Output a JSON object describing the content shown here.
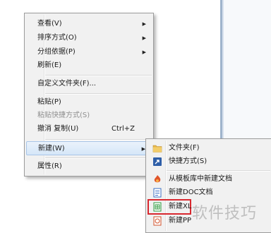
{
  "context_menu": {
    "items": [
      {
        "label": "查看(V)"
      },
      {
        "label": "排序方式(O)"
      },
      {
        "label": "分组依据(P)"
      },
      {
        "label": "刷新(E)"
      },
      {
        "label": "自定义文件夹(F)..."
      },
      {
        "label": "粘贴(P)"
      },
      {
        "label": "粘贴快捷方式(S)"
      },
      {
        "label": "撤消 复制(U)",
        "shortcut": "Ctrl+Z"
      },
      {
        "label": "新建(W)"
      },
      {
        "label": "属性(R)"
      }
    ]
  },
  "new_submenu": {
    "items": [
      {
        "label": "文件夹(F)",
        "icon": "folder-icon"
      },
      {
        "label": "快捷方式(S)",
        "icon": "shortcut-icon"
      },
      {
        "label": "从模板库中新建文档",
        "icon": "wps-template-icon"
      },
      {
        "label": "新建DOC文档",
        "icon": "doc-icon"
      },
      {
        "label": "新建XL",
        "icon": "xls-icon"
      },
      {
        "label": "新建PP",
        "icon": "ppt-icon"
      }
    ]
  },
  "watermark": {
    "text": "软件技巧"
  },
  "colors": {
    "menu_bg": "#f1f1f1",
    "highlight": "#d5e6f8",
    "focus_box": "#d8282f",
    "submenu_arrow": "#222222"
  }
}
